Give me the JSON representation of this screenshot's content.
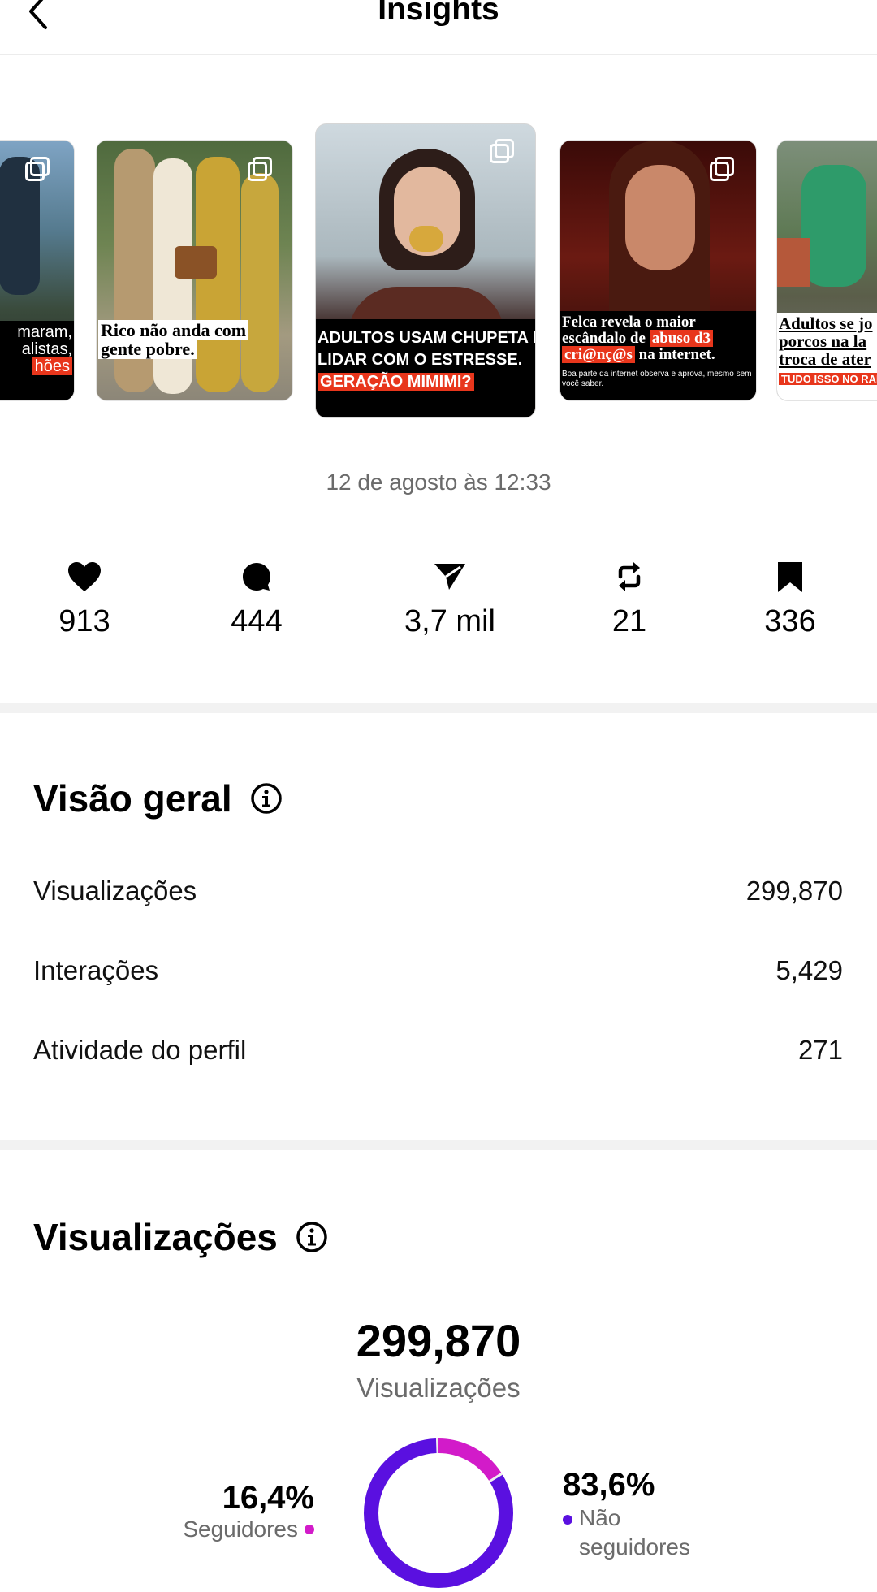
{
  "header": {
    "title": "Insights"
  },
  "carousel": {
    "card1": {
      "line1": "maram,",
      "line2": "alistas,",
      "line3": "hões"
    },
    "card2": {
      "line1": "Rico não anda com",
      "line2": "gente pobre."
    },
    "card3": {
      "line1": "ADULTOS USAM CHUPETA PARA",
      "line2": "LIDAR COM O ESTRESSE.",
      "line3": "GERAÇÃO MIMIMI?"
    },
    "card4": {
      "line1": "Felca revela o maior",
      "line2a": "escândalo de ",
      "line2b": "abuso d3",
      "line3a": "cri@nç@s",
      "line3b": " na internet.",
      "small": "Boa parte da internet observa e aprova, mesmo sem você saber."
    },
    "card5": {
      "line1": "Adultos se jo",
      "line2": "porcos na la",
      "line3": "troca de ater",
      "line4": "TUDO ISSO NO RANCHO DO"
    }
  },
  "timestamp": "12 de agosto às 12:33",
  "stats": {
    "likes": "913",
    "comments": "444",
    "shares": "3,7 mil",
    "reposts": "21",
    "saves": "336"
  },
  "overview": {
    "title": "Visão geral",
    "rows": [
      {
        "label": "Visualizações",
        "value": "299,870"
      },
      {
        "label": "Interações",
        "value": "5,429"
      },
      {
        "label": "Atividade do perfil",
        "value": "271"
      }
    ]
  },
  "views": {
    "title": "Visualizações",
    "total": "299,870",
    "total_label": "Visualizações",
    "followers_pct": "16,4%",
    "followers_label": "Seguidores",
    "nonfollowers_pct": "83,6%",
    "nonfollowers_label_1": "Não",
    "nonfollowers_label_2": "seguidores"
  },
  "chart_data": {
    "type": "pie",
    "categories": [
      "Seguidores",
      "Não seguidores"
    ],
    "values": [
      16.4,
      83.6
    ],
    "colors": [
      "#d21bc9",
      "#5a10e0"
    ]
  },
  "colors": {
    "followers": "#d21bc9",
    "nonfollowers": "#5a10e0",
    "accent_red": "#e8361c"
  }
}
